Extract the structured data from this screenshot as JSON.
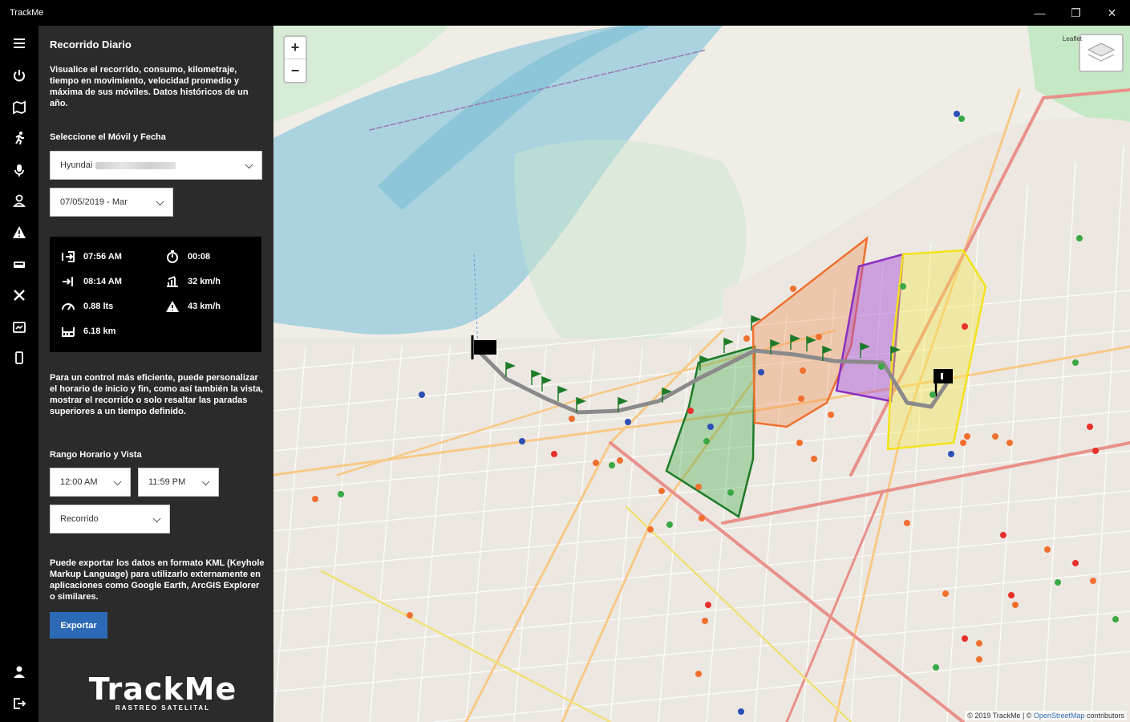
{
  "window": {
    "title": "TrackMe",
    "minimize": "—",
    "maximize": "❐",
    "close": "✕"
  },
  "rail": {
    "top_icons": [
      "menu-icon",
      "power-icon",
      "map-icon",
      "running-icon",
      "microphone-icon",
      "user-pin-icon",
      "warning-icon",
      "bus-icon",
      "tools-icon",
      "report-icon",
      "device-icon"
    ],
    "bottom_icons": [
      "account-icon",
      "logout-icon"
    ]
  },
  "panel": {
    "title": "Recorrido Diario",
    "description": "Visualice el recorrido, consumo, kilometraje, tiempo en movimiento, velocidad promedio y máxima de sus móviles. Datos históricos de un año.",
    "select_label": "Seleccione el Móvil y Fecha",
    "vehicle_value": "Hyundai",
    "date_value": "07/05/2019 - Mar",
    "stats": {
      "start_time": "07:56 AM",
      "end_time": "08:14 AM",
      "fuel": "0.88 lts",
      "distance": "6.18 km",
      "moving_time": "00:08",
      "avg_speed": "32 km/h",
      "max_speed": "43 km/h"
    },
    "info_text": "Para un control más eficiente, puede personalizar el horario de inicio y fin, como así también la vista, mostrar el recorrido o solo resaltar las paradas superiores a un tiempo definido.",
    "range_label": "Rango Horario y Vista",
    "time_from": "12:00 AM",
    "time_to": "11:59 PM",
    "view_value": "Recorrido",
    "export_text": "Puede exportar los datos en formato KML (Keyhole Markup Language) para utilizarlo externamente en aplicaciones como Google Earth, ArcGIS Explorer o similares.",
    "export_button": "Exportar",
    "logo_wordmark": "TrackMe",
    "logo_tagline": "RASTREO SATELITAL"
  },
  "map": {
    "zoom_in": "+",
    "zoom_out": "−",
    "layers_label": "Leaflet",
    "attribution_prefix": "© 2019 TrackMe | © ",
    "attribution_link": "OpenStreetMap",
    "attribution_suffix": " contributors",
    "colors": {
      "river": "#aad3df",
      "route": "#8a8a8a",
      "zone_green": "#3aa845",
      "zone_orange": "#f08a4b",
      "zone_purple": "#a34ad6",
      "zone_yellow": "#f5e94a"
    }
  }
}
